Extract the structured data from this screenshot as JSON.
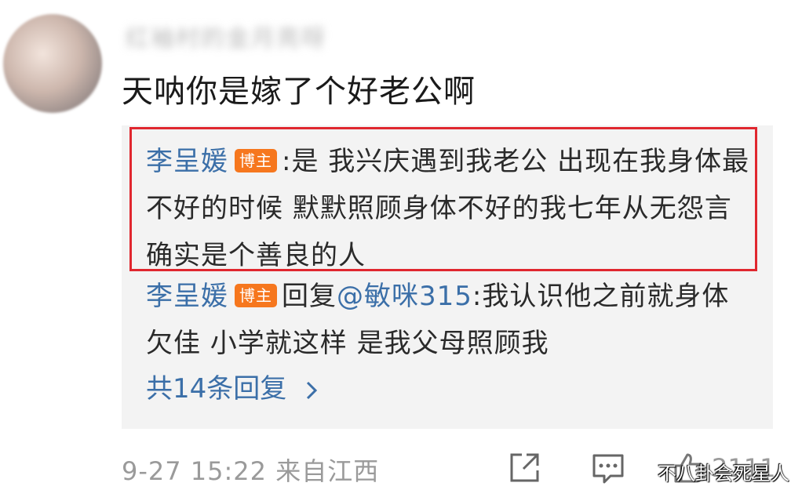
{
  "comment": {
    "username": "红袖村的金月亮呀",
    "text": "天呐你是嫁了个好老公啊"
  },
  "replies": [
    {
      "author": "李呈媛",
      "badge": "博主",
      "sep": ":",
      "text": "是 我兴庆遇到我老公 出现在我身体最不好的时候 默默照顾身体不好的我七年从无怨言 确实是个善良的人"
    },
    {
      "author": "李呈媛",
      "badge": "博主",
      "prefix": "回复",
      "mention": "@敏咪315",
      "text": ":我认识他之前就身体欠佳 小学就这样 是我父母照顾我"
    }
  ],
  "more_replies": "共14条回复",
  "meta": {
    "time": "9-27 15:22",
    "source": "来自江西"
  },
  "actions": {
    "like_count": "2111"
  },
  "watermark": "不八卦会死星人"
}
